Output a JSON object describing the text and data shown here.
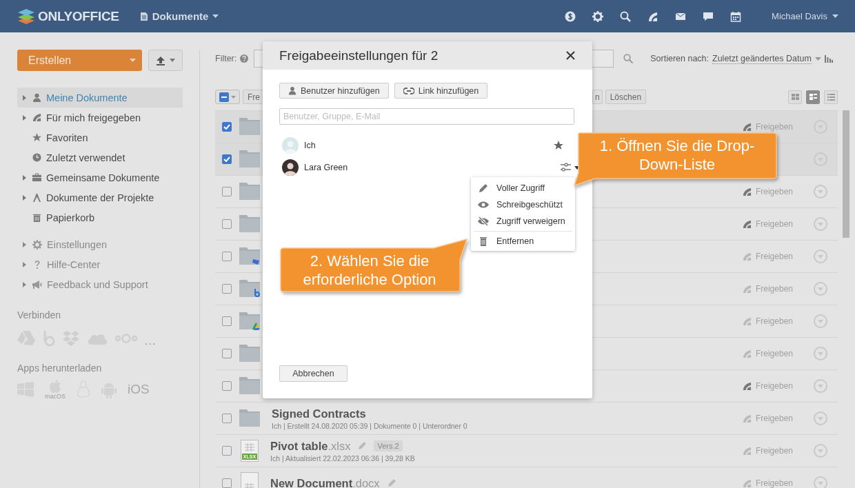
{
  "header": {
    "logo": "ONLYOFFICE",
    "module": "Dokumente",
    "user": "Michael Davis",
    "icons": [
      {
        "kind": "dollar"
      },
      {
        "kind": "gear"
      },
      {
        "kind": "search"
      },
      {
        "kind": "feed"
      },
      {
        "kind": "mail"
      },
      {
        "kind": "chat"
      },
      {
        "kind": "calendar"
      }
    ]
  },
  "sidebar": {
    "create": "Erstellen",
    "nav": [
      {
        "label": "Meine Dokumente",
        "expandable": true,
        "selected": true
      },
      {
        "label": "Für mich freigegeben",
        "expandable": true,
        "selected": false
      },
      {
        "label": "Favoriten",
        "expandable": false,
        "selected": false
      },
      {
        "label": "Zuletzt verwendet",
        "expandable": false,
        "selected": false
      },
      {
        "label": "Gemeinsame Dokumente",
        "expandable": true,
        "selected": false
      },
      {
        "label": "Dokumente der Projekte",
        "expandable": true,
        "selected": false
      },
      {
        "label": "Papierkorb",
        "expandable": false,
        "selected": false
      }
    ],
    "extra": [
      {
        "label": "Einstellungen",
        "expandable": true
      },
      {
        "label": "Hilfe-Center",
        "expandable": true
      },
      {
        "label": "Feedback und Support",
        "expandable": true
      }
    ],
    "connect": {
      "title": "Verbinden",
      "more": "..."
    },
    "apps": {
      "title": "Apps herunterladen",
      "macos": "macOS",
      "ios": "iOS"
    }
  },
  "main": {
    "filter_label": "Filter:",
    "sort_label": "Sortieren nach:",
    "sort_value": "Zuletzt geändertes Datum",
    "toolbar": [
      "Fre",
      "n",
      "Löschen"
    ],
    "views": [
      {
        "kind": "tiles",
        "selected": false
      },
      {
        "kind": "compact",
        "selected": true
      },
      {
        "kind": "list",
        "selected": false
      }
    ],
    "rows": [
      {
        "kind": "folder",
        "checked": true,
        "shared": true,
        "share_label": "Freigeben"
      },
      {
        "kind": "folder",
        "checked": true
      },
      {
        "kind": "folder",
        "checked": false,
        "shared": true,
        "share_label": "Freigeben"
      },
      {
        "kind": "folder",
        "checked": false,
        "shared": true,
        "share_label": "Freigeben"
      },
      {
        "kind": "folder",
        "checked": false,
        "shared": false,
        "share_label": "Freigeben"
      },
      {
        "kind": "folder",
        "checked": false,
        "shared": false,
        "share_label": "Freigeben"
      },
      {
        "kind": "folder",
        "checked": false,
        "shared": false,
        "share_label": "Freigeben"
      },
      {
        "kind": "folder",
        "checked": false,
        "shared": false,
        "share_label": "Freigeben"
      },
      {
        "kind": "folder",
        "checked": false,
        "shared": true,
        "share_label": "Freigeben"
      },
      {
        "kind": "folder",
        "checked": false,
        "shared": false,
        "share_label": "Freigeben",
        "name": "Signed Contracts",
        "meta": "Ich | Erstellt 24.08.2020 05:39 | Dokumente 0 | Unterordner 0"
      },
      {
        "kind": "file",
        "checked": false,
        "shared": false,
        "share_label": "Freigeben",
        "name": "Pivot table",
        "ext": ".xlsx",
        "file_type": "XLSX",
        "version": "Vers.2",
        "meta": "Ich | Aktualisiert 22.02.2023 06:36 | 39,28 KB"
      },
      {
        "kind": "file",
        "checked": false,
        "shared": false,
        "share_label": "Freigeben",
        "name": "New Document",
        "ext": ".docx"
      }
    ]
  },
  "dialog": {
    "title": "Freigabeeinstellungen für 2",
    "add_user": "Benutzer hinzufügen",
    "add_link": "Link hinzufügen",
    "placeholder": "Benutzer, Gruppe, E-Mail",
    "users": [
      {
        "name": "Ich"
      },
      {
        "name": "Lara Green"
      }
    ],
    "menu": [
      {
        "kind": "full",
        "label": "Voller Zugriff"
      },
      {
        "kind": "read",
        "label": "Schreibgeschützt"
      },
      {
        "kind": "deny",
        "label": "Zugriff verweigern"
      },
      {
        "kind": "remove",
        "label": "Entfernen"
      }
    ],
    "cancel": "Abbrechen"
  },
  "callouts": [
    {
      "text": "1. Öffnen Sie die Drop-Down-Liste"
    },
    {
      "text": "2. Wählen Sie die erforderliche Option"
    }
  ]
}
